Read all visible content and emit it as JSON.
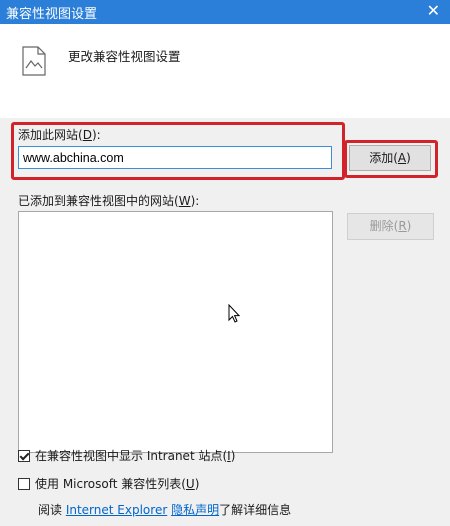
{
  "window": {
    "title": "兼容性视图设置",
    "close_symbol": "✕"
  },
  "header": {
    "icon": "document-image-icon",
    "text": "更改兼容性视图设置"
  },
  "add_site": {
    "label": "添加此网站(",
    "label_key": "D",
    "label_suffix": "):",
    "input_value": "www.abchina.com",
    "button_label": "添加(",
    "button_key": "A",
    "button_suffix": ")"
  },
  "added_sites": {
    "label": "已添加到兼容性视图中的网站(",
    "label_key": "W",
    "label_suffix": "):",
    "items": [],
    "remove_label": "删除(",
    "remove_key": "R",
    "remove_suffix": ")"
  },
  "options": {
    "intranet": {
      "label": "在兼容性视图中显示 Intranet 站点(",
      "key": "I",
      "suffix": ")",
      "checked": true
    },
    "ms_list": {
      "label": "使用 Microsoft 兼容性列表(",
      "key": "U",
      "suffix": ")",
      "checked": false
    }
  },
  "footer": {
    "prefix": "阅读 ",
    "link1": "Internet Explorer",
    "link2": "隐私声明",
    "suffix": "了解详细信息"
  },
  "colors": {
    "titlebar": "#2b7fd8",
    "highlight": "#d2232a",
    "link": "#0066cc"
  }
}
